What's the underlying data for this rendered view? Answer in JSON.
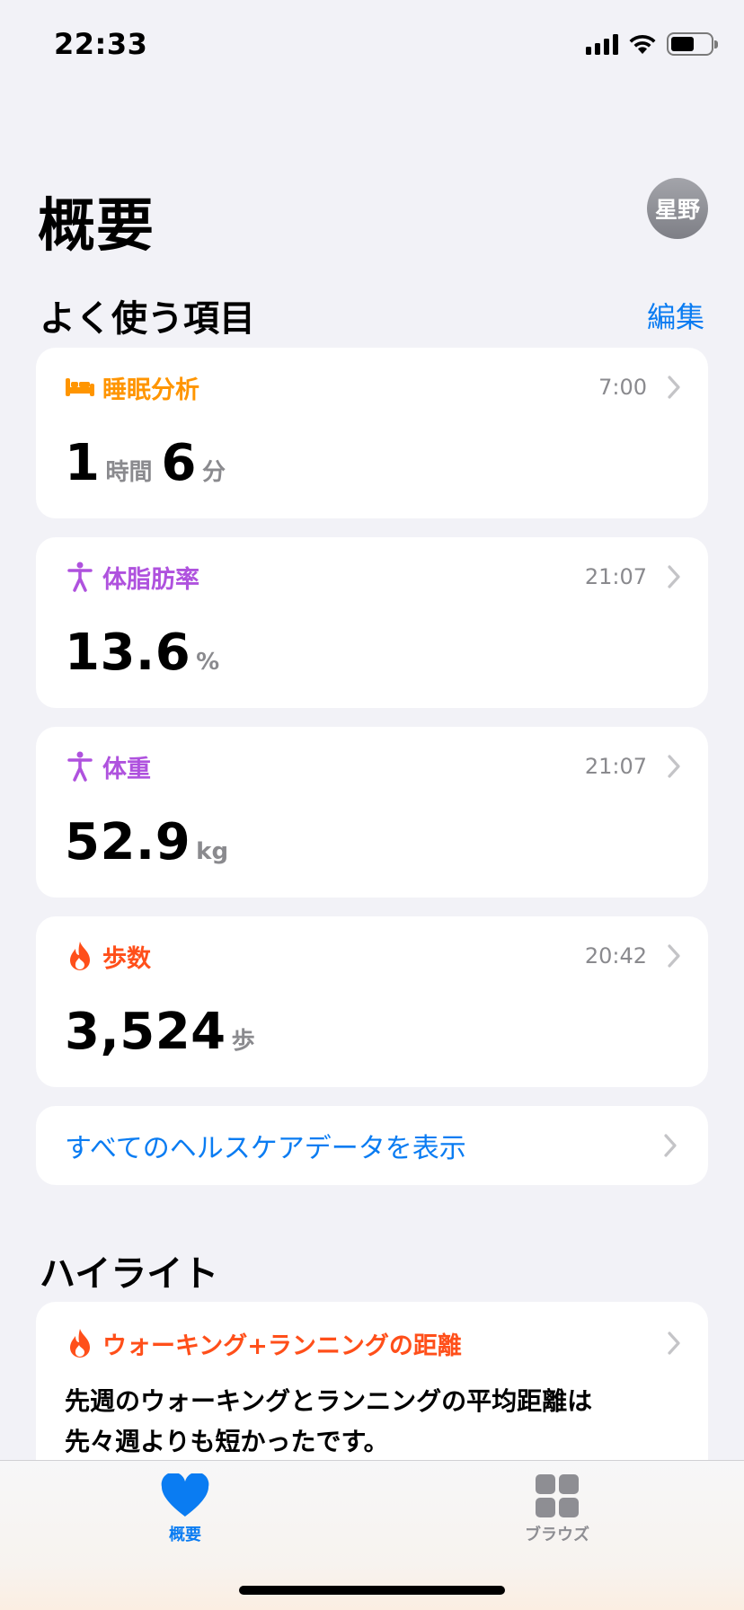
{
  "status": {
    "time": "22:33"
  },
  "header": {
    "title": "概要",
    "avatar_initials": "星野"
  },
  "favorites": {
    "title": "よく使う項目",
    "edit_label": "編集",
    "items": [
      {
        "label": "睡眠分析",
        "time": "7:00",
        "icon": "bed-icon",
        "color": "#ff9500",
        "value": [
          {
            "num": "1",
            "unit": "時間"
          },
          {
            "num": "6",
            "unit": "分"
          }
        ]
      },
      {
        "label": "体脂肪率",
        "time": "21:07",
        "icon": "body-figure-icon",
        "color": "#af52de",
        "value": [
          {
            "num": "13.6",
            "unit": "%"
          }
        ]
      },
      {
        "label": "体重",
        "time": "21:07",
        "icon": "body-figure-icon",
        "color": "#af52de",
        "value": [
          {
            "num": "52.9",
            "unit": "kg"
          }
        ]
      },
      {
        "label": "歩数",
        "time": "20:42",
        "icon": "flame-icon",
        "color": "#ff4f1a",
        "value": [
          {
            "num": "3,524",
            "unit": "歩"
          }
        ]
      }
    ],
    "show_all_label": "すべてのヘルスケアデータを表示"
  },
  "highlights": {
    "title": "ハイライト",
    "card": {
      "label": "ウォーキング+ランニングの距離",
      "icon": "flame-icon",
      "color": "#ff4f1a",
      "body_line1": "先週のウォーキングとランニングの平均距離は",
      "body_line2": "先々週よりも短かったです。"
    }
  },
  "tabbar": {
    "tabs": [
      {
        "label": "概要",
        "icon": "heart-icon",
        "color": "#0a7cf2",
        "selected": true
      },
      {
        "label": "ブラウズ",
        "icon": "grid-icon",
        "color": "#8e8e93",
        "selected": false
      }
    ]
  }
}
